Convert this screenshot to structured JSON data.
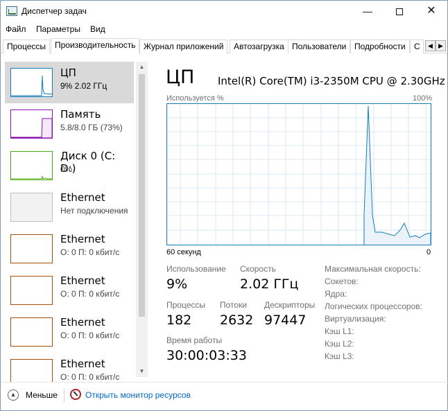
{
  "window": {
    "title": "Диспетчер задач",
    "minimize": "—",
    "close": "✕"
  },
  "menu": [
    "Файл",
    "Параметры",
    "Вид"
  ],
  "tabs": [
    "Процессы",
    "Производительность",
    "Журнал приложений",
    "Автозагрузка",
    "Пользователи",
    "Подробности",
    "С"
  ],
  "active_tab": "Производительность",
  "resources": [
    {
      "name": "ЦП",
      "sub": "9%  2.02 ГГц",
      "color": "#117dbb",
      "selected": true
    },
    {
      "name": "Память",
      "sub": "5.8/8.0 ГБ (73%)",
      "color": "#8b12ae"
    },
    {
      "name": "Диск 0 (C: D:)",
      "sub": "0%",
      "color": "#4da60c"
    },
    {
      "name": "Ethernet",
      "sub": "Нет подключения",
      "color": "#bfbfbf"
    },
    {
      "name": "Ethernet",
      "sub": "О: 0 П: 0 кбит/с",
      "color": "#a74f01"
    },
    {
      "name": "Ethernet",
      "sub": "О: 0 П: 0 кбит/с",
      "color": "#a74f01"
    },
    {
      "name": "Ethernet",
      "sub": "О: 0 П: 0 кбит/с",
      "color": "#a74f01"
    },
    {
      "name": "Ethernet",
      "sub": "О: 0 П: 0 кбит/с",
      "color": "#a74f01"
    }
  ],
  "detail": {
    "title": "ЦП",
    "model": "Intel(R) Core(TM) i3-2350M CPU @ 2.30GHz",
    "graph_top_left": "Используется %",
    "graph_top_right": "100%",
    "graph_bottom_left": "60 секунд",
    "graph_bottom_right": "0",
    "utilization_label": "Использование",
    "utilization_value": "9%",
    "speed_label": "Скорость",
    "speed_value": "2.02 ГГц",
    "processes_label": "Процессы",
    "processes_value": "182",
    "threads_label": "Потоки",
    "threads_value": "2632",
    "handles_label": "Дескрипторы",
    "handles_value": "97447",
    "uptime_label": "Время работы",
    "uptime_value": "30:00:03:33",
    "specs": [
      "Максимальная скорость:",
      "Сокетов:",
      "Ядра:",
      "Логических процессоров:",
      "Виртуализация:",
      "Кэш L1:",
      "Кэш L2:",
      "Кэш L3:"
    ]
  },
  "footer": {
    "less": "Меньше",
    "monitor": "Открыть монитор ресурсов"
  }
}
